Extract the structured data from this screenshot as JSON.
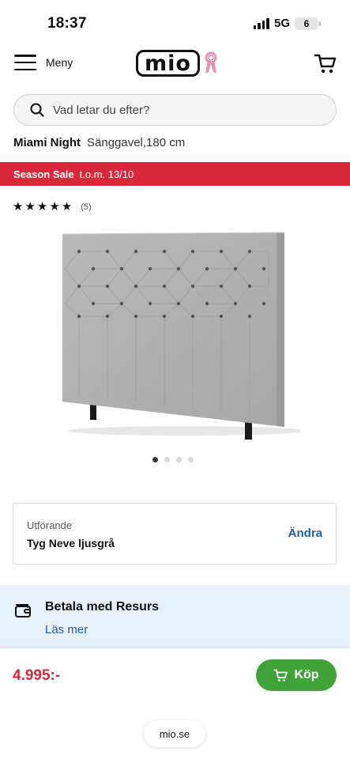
{
  "status_bar": {
    "time": "18:37",
    "network": "5G",
    "battery": "6"
  },
  "nav": {
    "menu_label": "Meny",
    "logo_text": "mio",
    "icons": {
      "menu": "hamburger-icon",
      "cart": "cart-icon",
      "ribbon": "pink-ribbon-icon"
    }
  },
  "search": {
    "placeholder": "Vad letar du efter?",
    "icon": "search-icon"
  },
  "product": {
    "name": "Miami Night",
    "description": "Sänggavel,180 cm",
    "rating": 5,
    "rating_max": 5,
    "review_count": "(5)",
    "image_count": 4,
    "active_image": 1
  },
  "sale": {
    "title": "Season Sale",
    "period": "t.o.m. 13/10",
    "color": "#d9283a"
  },
  "variant": {
    "label": "Utförande",
    "value": "Tyg Neve ljusgrå",
    "change_label": "Ändra"
  },
  "payment": {
    "title": "Betala med Resurs",
    "link": "Läs mer",
    "icon": "wallet-icon"
  },
  "purchase": {
    "price": "4.995:-",
    "buy_label": "Köp",
    "buy_color": "#3fa33a"
  },
  "browser": {
    "url": "mio.se"
  }
}
